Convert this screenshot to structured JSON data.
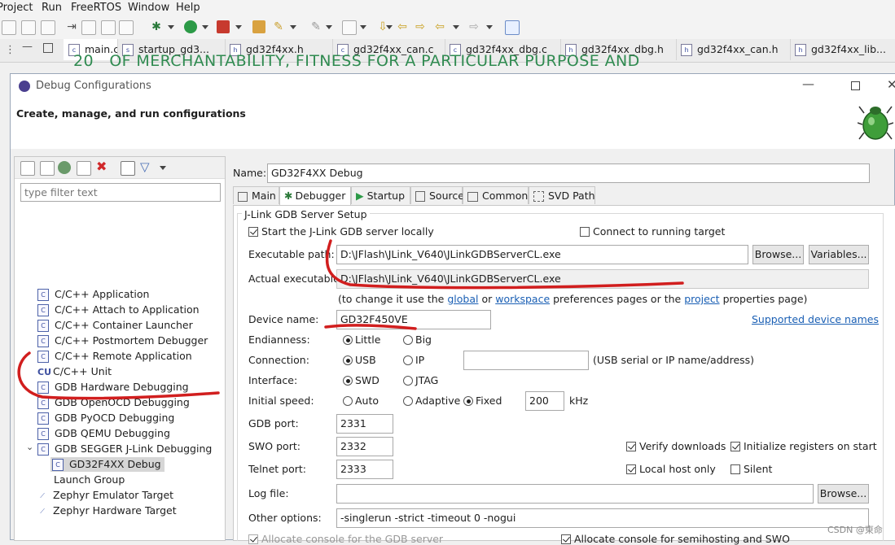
{
  "menu": [
    "Project",
    "Run",
    "FreeRTOS",
    "Window",
    "Help"
  ],
  "editor_tabs": [
    {
      "icon": "c",
      "label": "main.c"
    },
    {
      "icon": "s",
      "label": "startup_gd3..."
    },
    {
      "icon": "h",
      "label": "gd32f4xx.h"
    },
    {
      "icon": "c",
      "label": "gd32f4xx_can.c"
    },
    {
      "icon": "c",
      "label": "gd32f4xx_dbg.c"
    },
    {
      "icon": "h",
      "label": "gd32f4xx_dbg.h"
    },
    {
      "icon": "h",
      "label": "gd32f4xx_can.h"
    },
    {
      "icon": "h",
      "label": "gd32f4xx_lib..."
    }
  ],
  "code_line": {
    "number": "20",
    "text": "OF MERCHANTABILITY, FITNESS FOR A PARTICULAR PURPOSE AND"
  },
  "dialog": {
    "title": "Debug Configurations",
    "header": "Create, manage, and run configurations",
    "filter_placeholder": "type filter text",
    "tree": [
      {
        "icon": "C",
        "label": "C/C++ Application"
      },
      {
        "icon": "C",
        "label": "C/C++ Attach to Application"
      },
      {
        "icon": "C",
        "label": "C/C++ Container Launcher"
      },
      {
        "icon": "C",
        "label": "C/C++ Postmortem Debugger"
      },
      {
        "icon": "C",
        "label": "C/C++ Remote Application"
      },
      {
        "icon": "CU",
        "label": "C/C++ Unit"
      },
      {
        "icon": "C",
        "label": "GDB Hardware Debugging"
      },
      {
        "icon": "C",
        "label": "GDB OpenOCD Debugging"
      },
      {
        "icon": "C",
        "label": "GDB PyOCD Debugging"
      },
      {
        "icon": "C",
        "label": "GDB QEMU Debugging"
      },
      {
        "icon": "C",
        "label": "GDB SEGGER J-Link Debugging"
      },
      {
        "icon": "C",
        "label": "GD32F4XX Debug"
      },
      {
        "icon": "",
        "label": "Launch Group"
      },
      {
        "icon": "Z",
        "label": "Zephyr Emulator Target"
      },
      {
        "icon": "Z",
        "label": "Zephyr Hardware Target"
      }
    ],
    "name_label": "Name:",
    "name_value": "GD32F4XX Debug",
    "tabs": [
      "Main",
      "Debugger",
      "Startup",
      "Source",
      "Common",
      "SVD Path"
    ],
    "group_title": "J-Link GDB Server Setup",
    "start_server_label": "Start the J-Link GDB server locally",
    "connect_running_label": "Connect to running target",
    "exec_path_label": "Executable path:",
    "exec_path_value": "D:\\JFlash\\JLink_V640\\JLinkGDBServerCL.exe",
    "browse_label": "Browse...",
    "variables_label": "Variables...",
    "actual_exec_label": "Actual executable:",
    "actual_exec_value": "D:\\JFlash\\JLink_V640\\JLinkGDBServerCL.exe",
    "hint_prefix": "(to change it use the",
    "hint_global": "global",
    "hint_or": "or",
    "hint_workspace": "workspace",
    "hint_mid": "preferences pages or the",
    "hint_project": "project",
    "hint_suffix": "properties page)",
    "device_label": "Device name:",
    "device_value": "GD32F450VE",
    "supported_link": "Supported device names",
    "endian_label": "Endianness:",
    "endian_little": "Little",
    "endian_big": "Big",
    "connection_label": "Connection:",
    "conn_usb": "USB",
    "conn_ip": "IP",
    "conn_hint": "(USB serial or IP name/address)",
    "interface_label": "Interface:",
    "if_swd": "SWD",
    "if_jtag": "JTAG",
    "speed_label": "Initial speed:",
    "speed_auto": "Auto",
    "speed_adaptive": "Adaptive",
    "speed_fixed": "Fixed",
    "speed_value": "200",
    "speed_unit": "kHz",
    "gdb_port_label": "GDB port:",
    "gdb_port_value": "2331",
    "swo_port_label": "SWO port:",
    "swo_port_value": "2332",
    "telnet_port_label": "Telnet port:",
    "telnet_port_value": "2333",
    "verify_label": "Verify downloads",
    "init_regs_label": "Initialize registers on start",
    "localhost_label": "Local host only",
    "silent_label": "Silent",
    "log_label": "Log file:",
    "log_value": "",
    "other_label": "Other options:",
    "other_value": "-singlerun -strict -timeout 0 -nogui",
    "alloc_gdb_label": "Allocate console for the GDB server",
    "alloc_semi_label": "Allocate console for semihosting and SWO"
  },
  "watermark": "CSDN @東命"
}
